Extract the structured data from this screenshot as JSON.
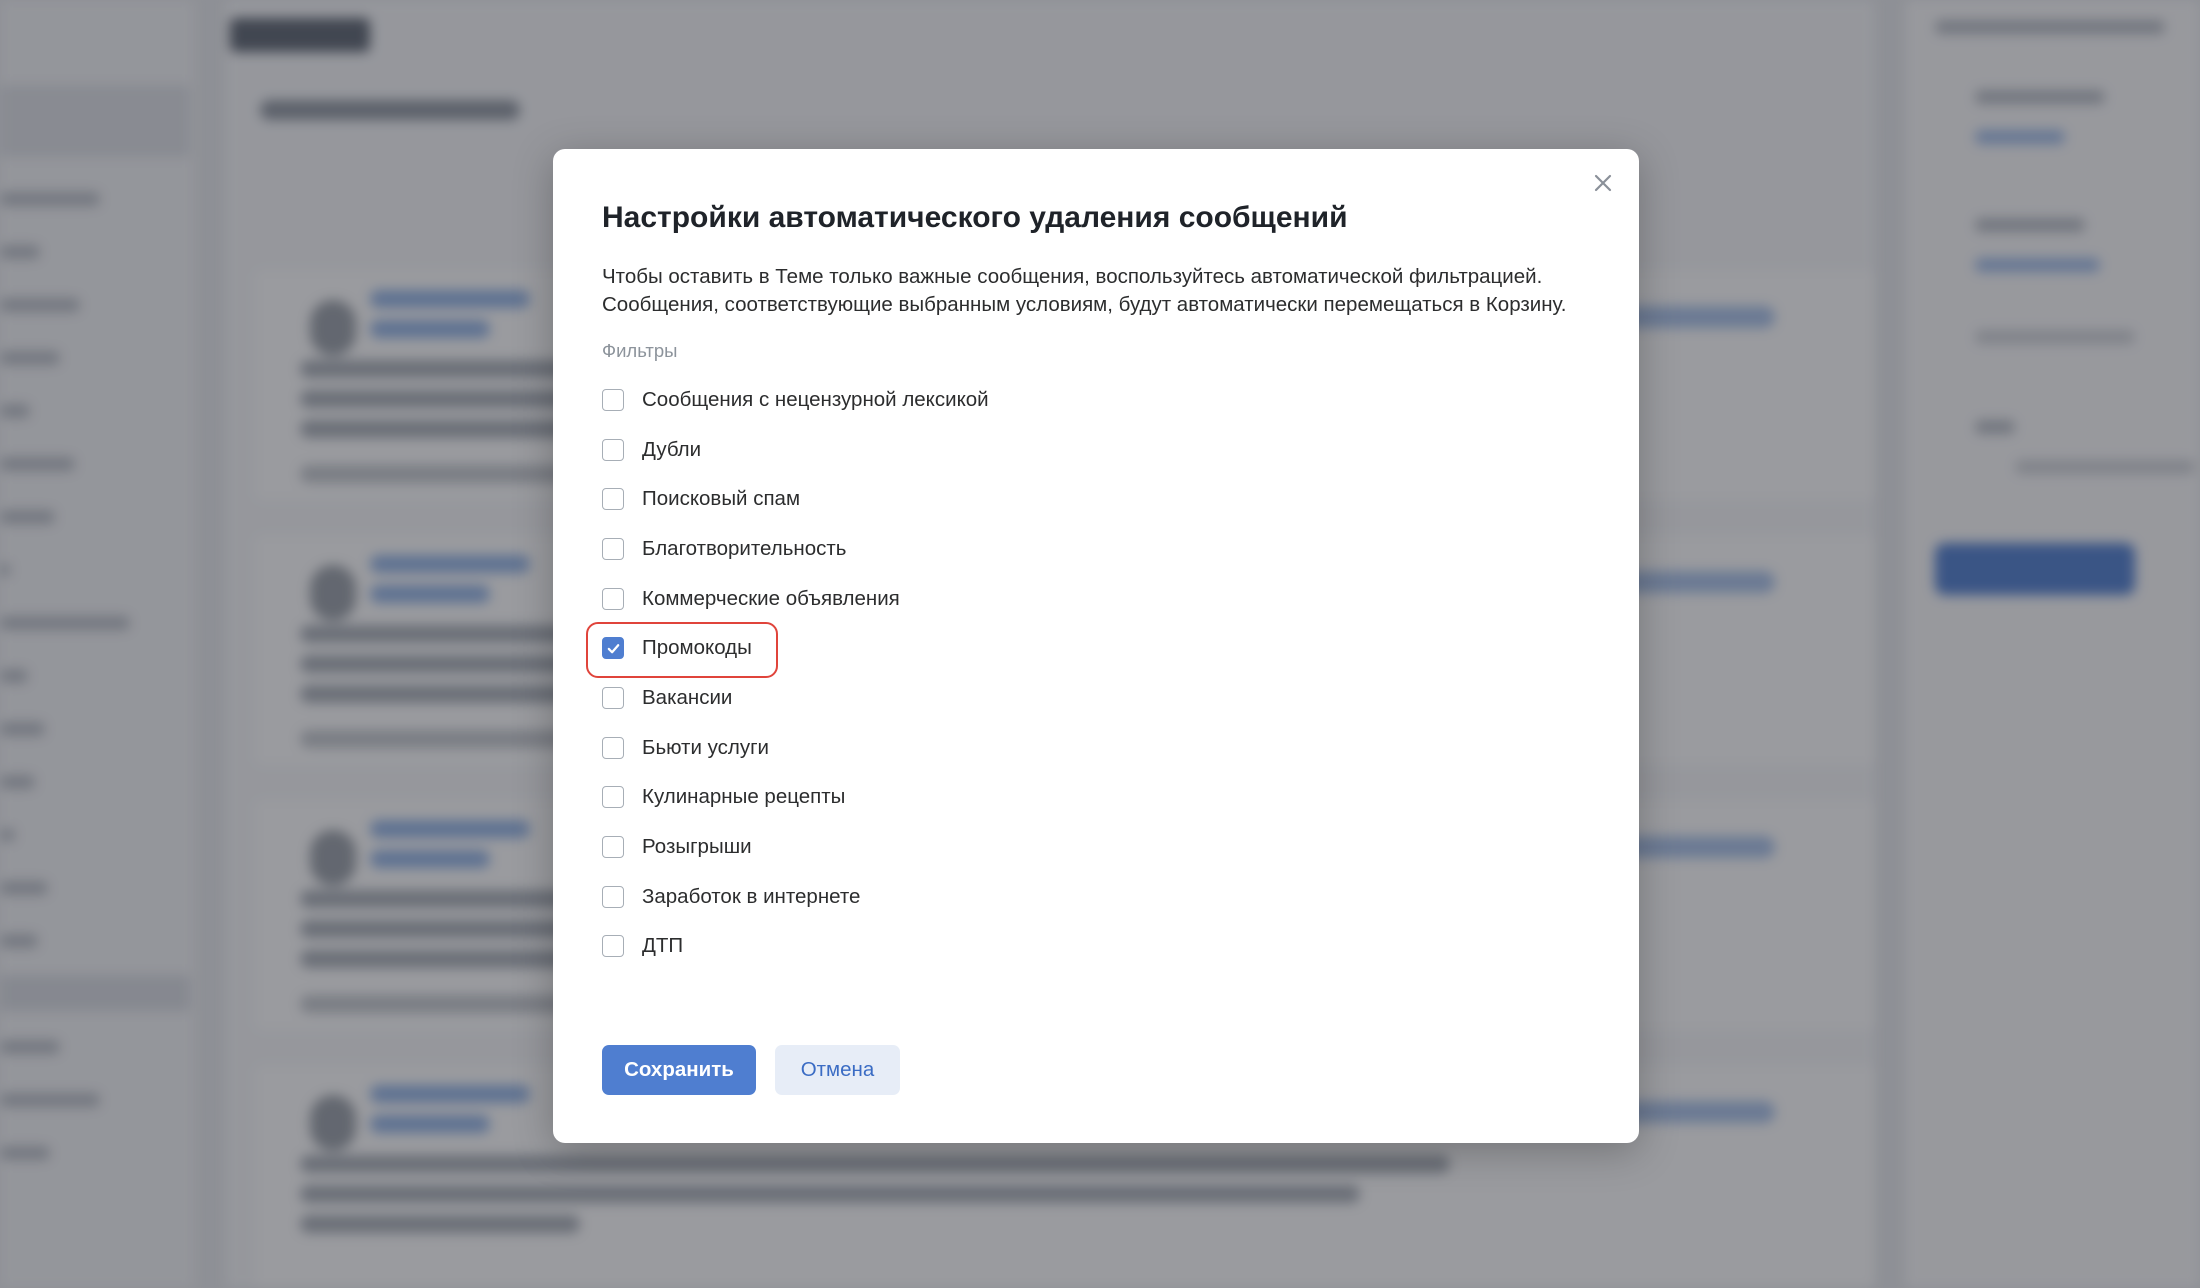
{
  "colors": {
    "accent": "#4f7ed0",
    "highlight_border": "#e0443b",
    "overlay": "rgba(34,38,46,0.46)"
  },
  "modal": {
    "title": "Настройки автоматического удаления сообщений",
    "description": "Чтобы оставить в Теме только важные сообщения, воспользуйтесь автоматической фильтрацией. Сообщения, соответствующие выбранным условиям, будут автоматически перемещаться в Корзину.",
    "filters_label": "Фильтры",
    "filters": [
      {
        "label": "Сообщения с нецензурной лексикой",
        "checked": false
      },
      {
        "label": "Дубли",
        "checked": false
      },
      {
        "label": "Поисковый спам",
        "checked": false
      },
      {
        "label": "Благотворительность",
        "checked": false
      },
      {
        "label": "Коммерческие объявления",
        "checked": false
      },
      {
        "label": "Промокоды",
        "checked": true
      },
      {
        "label": "Вакансии",
        "checked": false
      },
      {
        "label": "Бьюти услуги",
        "checked": false
      },
      {
        "label": "Кулинарные рецепты",
        "checked": false
      },
      {
        "label": "Розыгрыши",
        "checked": false
      },
      {
        "label": "Заработок в интернете",
        "checked": false
      },
      {
        "label": "ДТП",
        "checked": false
      }
    ],
    "save_label": "Сохранить",
    "cancel_label": "Отмена",
    "close_icon": "close-icon",
    "check_icon": "checkmark-icon"
  }
}
